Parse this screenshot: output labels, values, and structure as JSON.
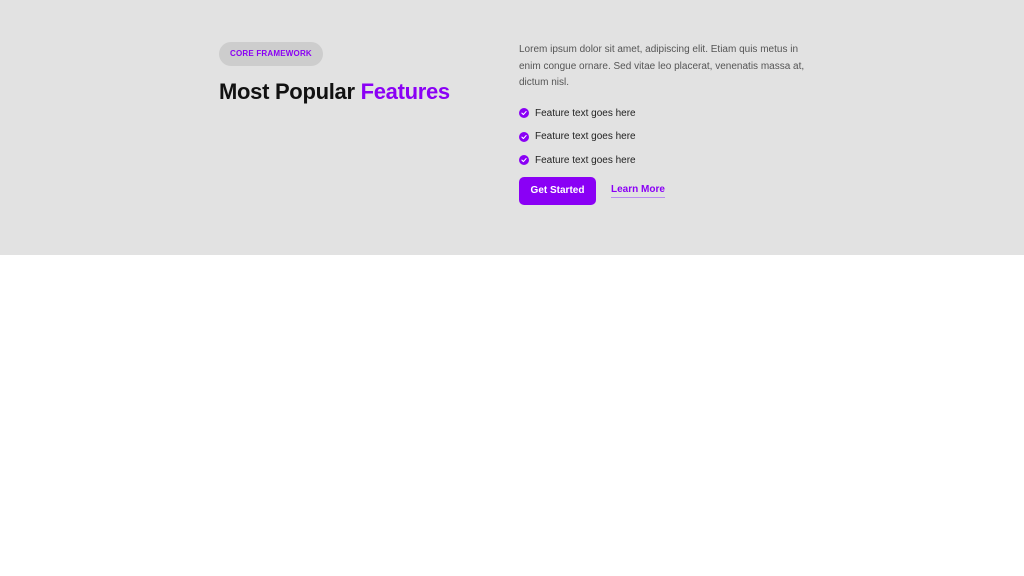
{
  "colors": {
    "accent": "#8a00f5",
    "section_background": "#e2e2e2",
    "page_background": "#ffffff"
  },
  "hero": {
    "badge": "CORE FRAMEWORK",
    "headline_main": "Most Popular ",
    "headline_accent": "Features",
    "paragraph": "Lorem ipsum dolor sit amet, adipiscing elit. Etiam quis metus in enim congue ornare. Sed vitae leo placerat, venenatis massa at, dictum nisl.",
    "features": [
      {
        "icon": "check-circle-icon",
        "text": "Feature text goes here"
      },
      {
        "icon": "check-circle-icon",
        "text": "Feature text goes here"
      },
      {
        "icon": "check-circle-icon",
        "text": "Feature text goes here"
      }
    ],
    "primary_button": "Get Started",
    "secondary_link": "Learn More"
  }
}
